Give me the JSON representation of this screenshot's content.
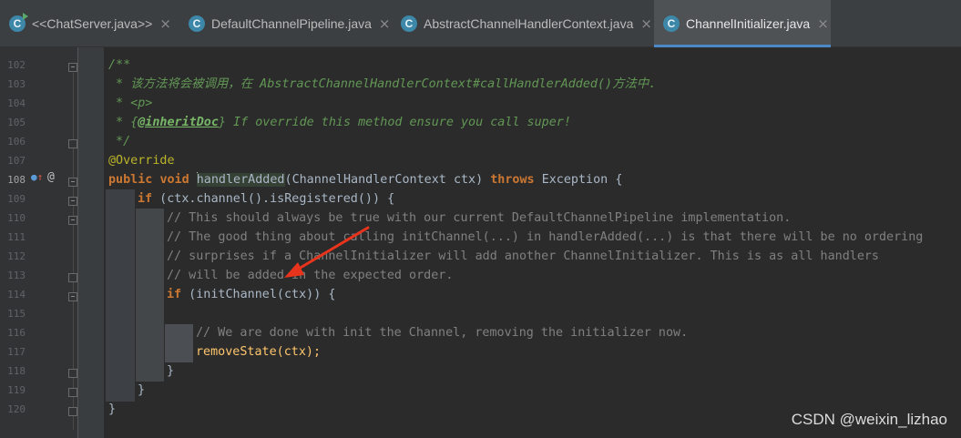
{
  "tabs": [
    {
      "label": "<<ChatServer.java>>",
      "icon": "class-run-icon",
      "active": false
    },
    {
      "label": "DefaultChannelPipeline.java",
      "icon": "class-icon",
      "active": false
    },
    {
      "label": "AbstractChannelHandlerContext.java",
      "icon": "abstract-class-icon",
      "active": false
    },
    {
      "label": "ChannelInitializer.java",
      "icon": "abstract-class-icon",
      "active": true
    }
  ],
  "tab_icon_letter": "C",
  "tab_close_glyph": "×",
  "line_numbers": [
    "102",
    "103",
    "104",
    "105",
    "106",
    "107",
    "108",
    "109",
    "110",
    "111",
    "112",
    "113",
    "114",
    "115",
    "116",
    "117",
    "118",
    "119",
    "120"
  ],
  "current_line": "108",
  "gutter_icons": {
    "override": "override-up-icon",
    "annotation": "@"
  },
  "code": {
    "l102": "/**",
    "l103": " * 该方法将会被调用，在 AbstractChannelHandlerContext#callHandlerAdded()方法中.",
    "l104_prefix": " * ",
    "l104_tag": "<p>",
    "l105_prefix": " * ",
    "l105_brace_open": "{",
    "l105_tag": "@inheritDoc",
    "l105_rest": "} If override this method ensure you call super!",
    "l106": " */",
    "l107": "@Override",
    "l108_kw1": "public",
    "l108_kw2": "void",
    "l108_method": "handlerAdded",
    "l108_paren_open": "(",
    "l108_type": "ChannelHandlerContext",
    "l108_param": "ctx",
    "l108_paren_close": ")",
    "l108_throws": "throws",
    "l108_exception": "Exception",
    "l108_brace": "{",
    "l109_if": "if",
    "l109_rest": " (ctx.channel().isRegistered()) {",
    "l110": "// This should always be true with our current DefaultChannelPipeline implementation.",
    "l111": "// The good thing about calling initChannel(...) in handlerAdded(...) is that there will be no ordering",
    "l112": "// surprises if a ChannelInitializer will add another ChannelInitializer. This is as all handlers",
    "l113": "// will be added in the expected order.",
    "l114_if": "if",
    "l114_rest": " (initChannel(ctx)) {",
    "l116": "// We are done with init the Channel, removing the initializer now.",
    "l117": "removeState(ctx);",
    "l118": "}",
    "l119": "}",
    "l120": "}"
  },
  "watermark": "CSDN @weixin_lizhao",
  "colors": {
    "background": "#2b2b2b",
    "comment": "#808080",
    "javadoc": "#629755",
    "keyword": "#cc7832",
    "annotation": "#bbb529",
    "arrow": "#e8341c",
    "active_tab_underline": "#4a88c7"
  }
}
